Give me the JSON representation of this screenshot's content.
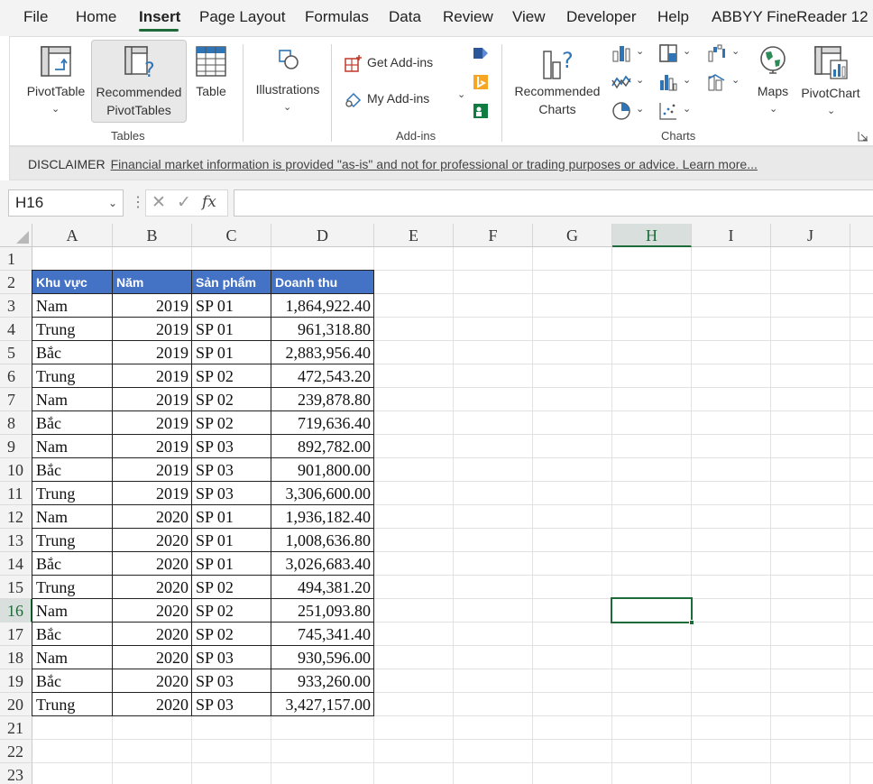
{
  "menu": {
    "tabs": [
      "File",
      "Home",
      "Insert",
      "Page Layout",
      "Formulas",
      "Data",
      "Review",
      "View",
      "Developer",
      "Help",
      "ABBYY FineReader 12"
    ],
    "active": "Insert"
  },
  "ribbon": {
    "tables": {
      "pivot_table": "PivotTable",
      "rec_pivot_1": "Recommended",
      "rec_pivot_2": "PivotTables",
      "table": "Table",
      "group": "Tables"
    },
    "illustrations": "Illustrations",
    "addins": {
      "get": "Get Add-ins",
      "my": "My Add-ins",
      "group": "Add-ins"
    },
    "charts": {
      "rec_1": "Recommended",
      "rec_2": "Charts",
      "maps": "Maps",
      "pivot_chart": "PivotChart",
      "group": "Charts"
    }
  },
  "disclaimer": {
    "label": "DISCLAIMER",
    "text": "Financial market information is provided \"as-is\" and not for professional or trading purposes or advice. Learn more..."
  },
  "formula_bar": {
    "name_box": "H16",
    "fx": "fx",
    "value": ""
  },
  "grid": {
    "columns": [
      "A",
      "B",
      "C",
      "D",
      "E",
      "F",
      "G",
      "H",
      "I",
      "J"
    ],
    "selected_column": "H",
    "selected_row": "16",
    "rows": [
      "1",
      "2",
      "3",
      "4",
      "5",
      "6",
      "7",
      "8",
      "9",
      "10",
      "11",
      "12",
      "13",
      "14",
      "15",
      "16",
      "17",
      "18",
      "19",
      "20",
      "21",
      "22",
      "23"
    ],
    "table_headers": [
      "Khu vực",
      "Năm",
      "Sản phẩm",
      "Doanh thu"
    ],
    "table_rows": [
      [
        "Nam",
        "2019",
        "SP 01",
        "1,864,922.40"
      ],
      [
        "Trung",
        "2019",
        "SP 01",
        "961,318.80"
      ],
      [
        "Bắc",
        "2019",
        "SP 01",
        "2,883,956.40"
      ],
      [
        "Trung",
        "2019",
        "SP 02",
        "472,543.20"
      ],
      [
        "Nam",
        "2019",
        "SP 02",
        "239,878.80"
      ],
      [
        "Bắc",
        "2019",
        "SP 02",
        "719,636.40"
      ],
      [
        "Nam",
        "2019",
        "SP 03",
        "892,782.00"
      ],
      [
        "Bắc",
        "2019",
        "SP 03",
        "901,800.00"
      ],
      [
        "Trung",
        "2019",
        "SP 03",
        "3,306,600.00"
      ],
      [
        "Nam",
        "2020",
        "SP 01",
        "1,936,182.40"
      ],
      [
        "Trung",
        "2020",
        "SP 01",
        "1,008,636.80"
      ],
      [
        "Bắc",
        "2020",
        "SP 01",
        "3,026,683.40"
      ],
      [
        "Trung",
        "2020",
        "SP 02",
        "494,381.20"
      ],
      [
        "Nam",
        "2020",
        "SP 02",
        "251,093.80"
      ],
      [
        "Bắc",
        "2020",
        "SP 02",
        "745,341.40"
      ],
      [
        "Nam",
        "2020",
        "SP 03",
        "930,596.00"
      ],
      [
        "Bắc",
        "2020",
        "SP 03",
        "933,260.00"
      ],
      [
        "Trung",
        "2020",
        "SP 03",
        "3,427,157.00"
      ]
    ]
  },
  "colors": {
    "accent": "#1e6b3a",
    "header_fill": "#4472c4"
  }
}
